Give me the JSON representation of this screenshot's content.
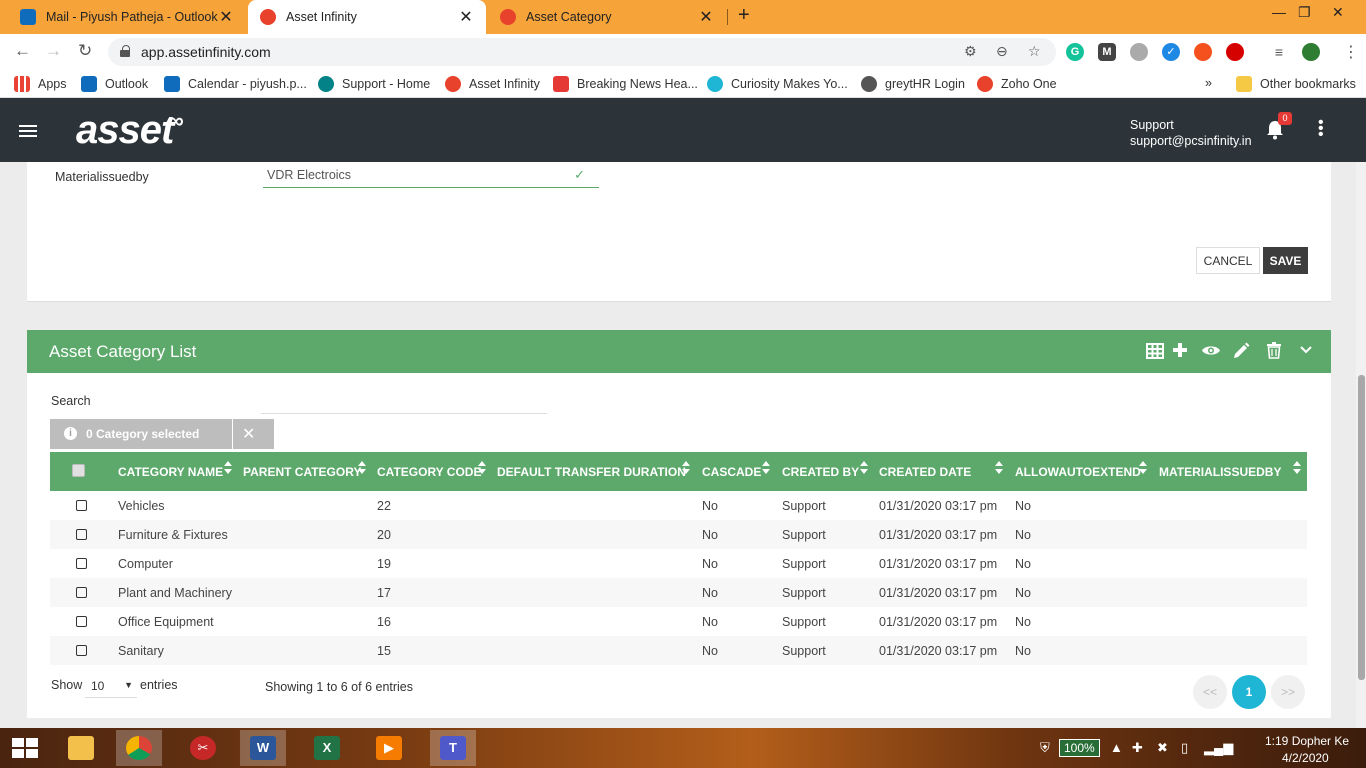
{
  "browser": {
    "tabs": [
      {
        "title": "Mail - Piyush Patheja - Outlook",
        "icon": "outlook-icon",
        "color": "#0f6cbd",
        "active": false
      },
      {
        "title": "Asset Infinity",
        "icon": "asset-infinity-icon",
        "color": "#e8412c",
        "active": true
      },
      {
        "title": "Asset Category",
        "icon": "asset-infinity-icon",
        "color": "#e8412c",
        "active": false
      }
    ],
    "new_tab": "+",
    "url": "app.assetinfinity.com",
    "bookmarks": [
      {
        "label": "Apps",
        "icon": "apps-grid-icon",
        "color": "#ea4335"
      },
      {
        "label": "Outlook",
        "icon": "outlook-icon",
        "color": "#0f6cbd"
      },
      {
        "label": "Calendar - piyush.p...",
        "icon": "calendar-icon",
        "color": "#0f6cbd"
      },
      {
        "label": "Support - Home",
        "icon": "sharepoint-icon",
        "color": "#038387"
      },
      {
        "label": "Asset Infinity",
        "icon": "asset-infinity-icon",
        "color": "#e8412c"
      },
      {
        "label": "Breaking News Hea...",
        "icon": "news-icon",
        "color": "#e53935"
      },
      {
        "label": "Curiosity Makes Yo...",
        "icon": "curiosity-icon",
        "color": "#1fb5d4"
      },
      {
        "label": "greytHR Login",
        "icon": "globe-icon",
        "color": "#555555"
      },
      {
        "label": "Zoho One",
        "icon": "zoho-icon",
        "color": "#e8412c"
      }
    ],
    "bookmarks_overflow": "»",
    "other_bookmarks": "Other bookmarks"
  },
  "header": {
    "logo": "asset",
    "user_name": "Support",
    "user_email": "support@pcsinfinity.in",
    "notification_count": "0"
  },
  "form": {
    "field_label": "Materialissuedby",
    "field_value": "VDR Electroics",
    "cancel_label": "CANCEL",
    "save_label": "SAVE"
  },
  "list": {
    "title": "Asset Category List",
    "search_label": "Search",
    "search_placeholder": "",
    "selection_text": "0 Category selected",
    "columns": [
      "CATEGORY NAME",
      "PARENT CATEGORY",
      "CATEGORY CODE",
      "DEFAULT TRANSFER DURATION",
      "CASCADE",
      "CREATED BY",
      "CREATED DATE",
      "ALLOWAUTOEXTEND",
      "MATERIALISSUEDBY"
    ],
    "rows": [
      {
        "name": "Vehicles",
        "parent": "",
        "code": "22",
        "duration": "",
        "cascade": "No",
        "created_by": "Support",
        "created_date": "01/31/2020 03:17 pm",
        "auto_extend": "No",
        "issued_by": ""
      },
      {
        "name": "Furniture & Fixtures",
        "parent": "",
        "code": "20",
        "duration": "",
        "cascade": "No",
        "created_by": "Support",
        "created_date": "01/31/2020 03:17 pm",
        "auto_extend": "No",
        "issued_by": ""
      },
      {
        "name": "Computer",
        "parent": "",
        "code": "19",
        "duration": "",
        "cascade": "No",
        "created_by": "Support",
        "created_date": "01/31/2020 03:17 pm",
        "auto_extend": "No",
        "issued_by": ""
      },
      {
        "name": "Plant and Machinery",
        "parent": "",
        "code": "17",
        "duration": "",
        "cascade": "No",
        "created_by": "Support",
        "created_date": "01/31/2020 03:17 pm",
        "auto_extend": "No",
        "issued_by": ""
      },
      {
        "name": "Office Equipment",
        "parent": "",
        "code": "16",
        "duration": "",
        "cascade": "No",
        "created_by": "Support",
        "created_date": "01/31/2020 03:17 pm",
        "auto_extend": "No",
        "issued_by": ""
      },
      {
        "name": "Sanitary",
        "parent": "",
        "code": "15",
        "duration": "",
        "cascade": "No",
        "created_by": "Support",
        "created_date": "01/31/2020 03:17 pm",
        "auto_extend": "No",
        "issued_by": ""
      }
    ],
    "show_label": "Show",
    "page_size": "10",
    "entries_label": "entries",
    "showing_text": "Showing 1 to 6 of 6 entries",
    "pagination": {
      "prev": "<<",
      "current": "1",
      "next": ">>"
    }
  },
  "taskbar": {
    "battery": "100%",
    "time": "1:19 Dopher Ke",
    "date": "4/2/2020"
  },
  "colors": {
    "accent_green": "#5ca96b",
    "header_dark": "#2c3439",
    "page_active": "#1fb5d4",
    "chrome_tabstrip": "#f6a33a"
  }
}
